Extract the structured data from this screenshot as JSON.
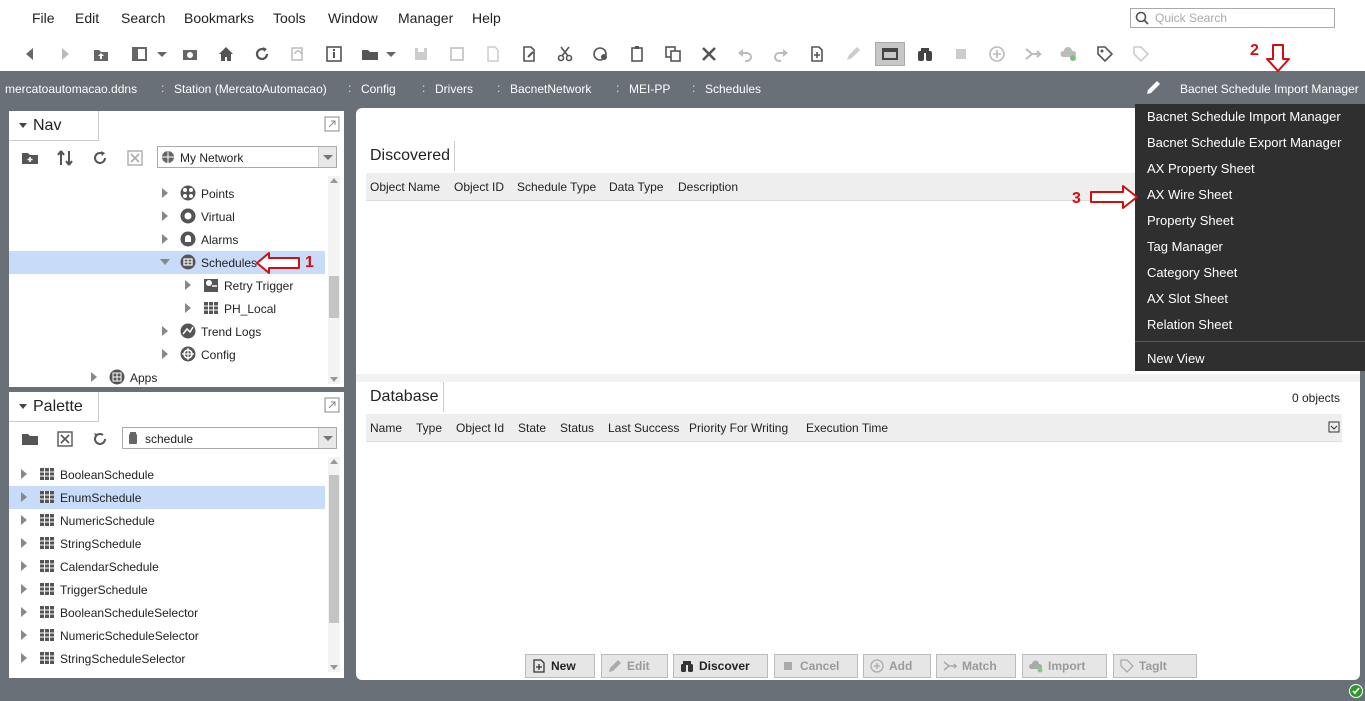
{
  "menubar": {
    "items": [
      "File",
      "Edit",
      "Search",
      "Bookmarks",
      "Tools",
      "Window",
      "Manager",
      "Help"
    ],
    "quick_search_placeholder": "Quick Search"
  },
  "breadcrumb": {
    "items": [
      "mercatoautomacao.ddns",
      "Station (MercatoAutomacao)",
      "Config",
      "Drivers",
      "BacnetNetwork",
      "MEI-PP",
      "Schedules"
    ],
    "view_selector": "Bacnet Schedule Import Manager"
  },
  "nav_panel": {
    "title": "Nav",
    "combo_value": "My Network",
    "tree": [
      {
        "label": "Points",
        "icon": "points-icon"
      },
      {
        "label": "Virtual",
        "icon": "virtual-icon"
      },
      {
        "label": "Alarms",
        "icon": "alarm-icon"
      },
      {
        "label": "Schedules",
        "icon": "schedule-icon",
        "selected": true,
        "expanded": true
      },
      {
        "label": "Retry Trigger",
        "icon": "trigger-icon"
      },
      {
        "label": "PH_Local",
        "icon": "grid-icon"
      },
      {
        "label": "Trend Logs",
        "icon": "trend-icon"
      },
      {
        "label": "Config",
        "icon": "config-icon"
      },
      {
        "label": "Apps",
        "icon": "apps-icon"
      }
    ]
  },
  "palette_panel": {
    "title": "Palette",
    "combo_value": "schedule",
    "items": [
      {
        "label": "BooleanSchedule"
      },
      {
        "label": "EnumSchedule",
        "selected": true
      },
      {
        "label": "NumericSchedule"
      },
      {
        "label": "StringSchedule"
      },
      {
        "label": "CalendarSchedule"
      },
      {
        "label": "TriggerSchedule"
      },
      {
        "label": "BooleanScheduleSelector"
      },
      {
        "label": "NumericScheduleSelector"
      },
      {
        "label": "StringScheduleSelector"
      }
    ]
  },
  "discovered": {
    "title": "Discovered",
    "columns": [
      "Object Name",
      "Object ID",
      "Schedule Type",
      "Data Type",
      "Description"
    ]
  },
  "database": {
    "title": "Database",
    "count": "0 objects",
    "columns": [
      "Name",
      "Type",
      "Object Id",
      "State",
      "Status",
      "Last Success",
      "Priority For Writing",
      "Execution Time"
    ]
  },
  "buttons": [
    {
      "label": "New",
      "enabled": true,
      "icon": "new-icon"
    },
    {
      "label": "Edit",
      "enabled": false,
      "icon": "pencil-icon"
    },
    {
      "label": "Discover",
      "enabled": true,
      "icon": "binoculars-icon"
    },
    {
      "label": "Cancel",
      "enabled": false,
      "icon": "stop-icon"
    },
    {
      "label": "Add",
      "enabled": false,
      "icon": "add-icon"
    },
    {
      "label": "Match",
      "enabled": false,
      "icon": "match-icon"
    },
    {
      "label": "Import",
      "enabled": false,
      "icon": "import-icon"
    },
    {
      "label": "TagIt",
      "enabled": false,
      "icon": "tag-icon"
    }
  ],
  "view_menu": {
    "items": [
      "Bacnet Schedule Import Manager",
      "Bacnet Schedule Export Manager",
      "AX Property Sheet",
      "AX Wire Sheet",
      "Property Sheet",
      "Tag Manager",
      "Category Sheet",
      "AX Slot Sheet",
      "Relation Sheet",
      "New View"
    ]
  },
  "annotations": [
    "1",
    "2",
    "3"
  ],
  "colors": {
    "chrome": "#6a7078",
    "selection": "#c8dbf8",
    "menu_bg": "#2f2f2f",
    "annotation": "#d01010"
  }
}
